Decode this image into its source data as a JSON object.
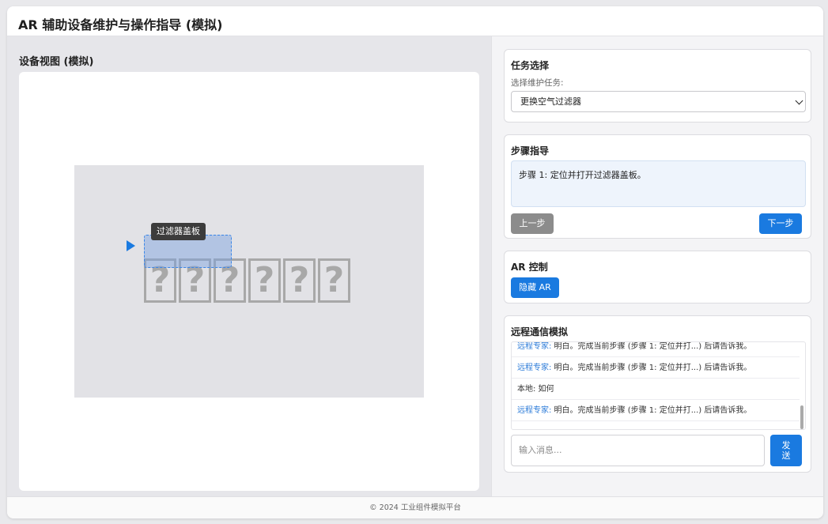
{
  "header": {
    "title": "AR 辅助设备维护与操作指导 (模拟)"
  },
  "view": {
    "title": "设备视图 (模拟)",
    "tooltip": "过滤器盖板",
    "glyphs": [
      "?",
      "?",
      "?",
      "?",
      "?",
      "?"
    ]
  },
  "task": {
    "title": "任务选择",
    "label": "选择维护任务:",
    "selected": "更换空气过滤器"
  },
  "steps": {
    "title": "步骤指导",
    "current": "步骤 1: 定位并打开过滤器盖板。",
    "prev_label": "上一步",
    "next_label": "下一步"
  },
  "ar": {
    "title": "AR 控制",
    "toggle_label": "隐藏 AR"
  },
  "comm": {
    "title": "远程通信模拟",
    "messages": [
      {
        "who": "远程专家:",
        "text": " 明白。完成当前步骤 (步骤 1: 定位并打...) 后请告诉我。",
        "remote": true
      },
      {
        "who": "远程专家:",
        "text": " 明白。完成当前步骤 (步骤 1: 定位并打...) 后请告诉我。",
        "remote": true
      },
      {
        "who": "本地:",
        "text": " 如何",
        "remote": false
      },
      {
        "who": "远程专家:",
        "text": " 明白。完成当前步骤 (步骤 1: 定位并打...) 后请告诉我。",
        "remote": true
      }
    ],
    "input_placeholder": "输入消息...",
    "send_label_1": "发",
    "send_label_2": "送"
  },
  "footer": {
    "text": "© 2024 工业组件模拟平台"
  },
  "colors": {
    "accent": "#1a7ae0",
    "disabled": "#8c8c8c",
    "remote_name": "#2a7ad8"
  }
}
